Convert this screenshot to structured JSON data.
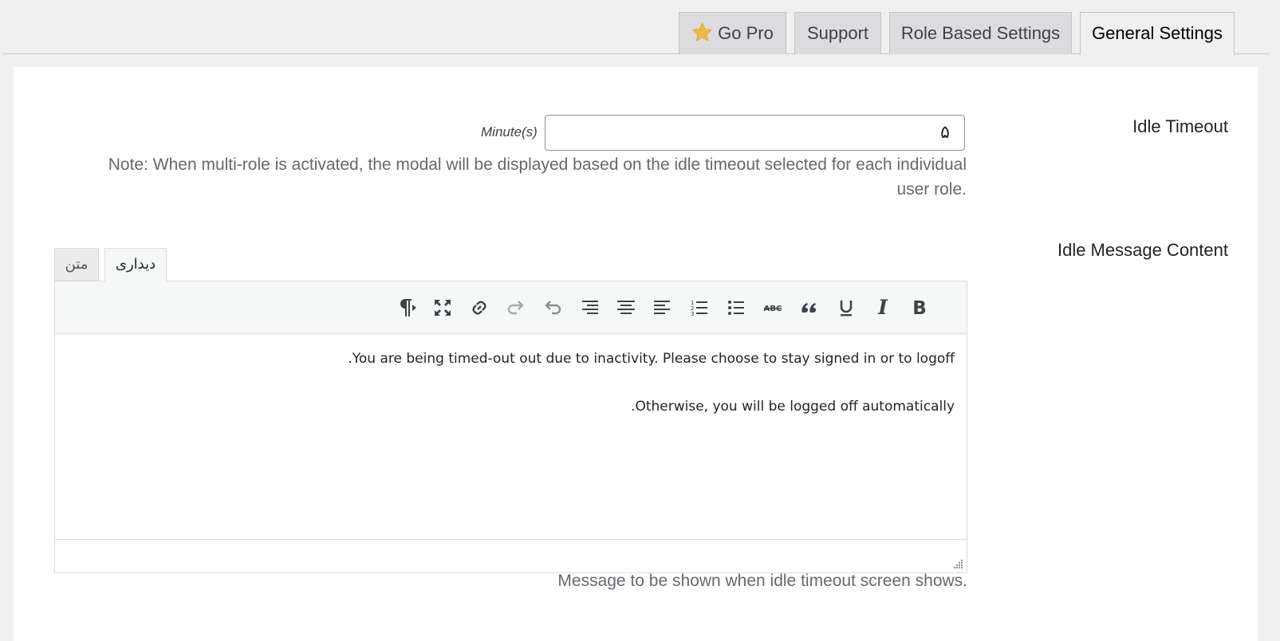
{
  "nav_tabs": [
    {
      "label": "Go Pro",
      "icon": "star-icon",
      "active": false
    },
    {
      "label": "Support",
      "active": false
    },
    {
      "label": "Role Based Settings",
      "active": false
    },
    {
      "label": "General Settings",
      "active": true
    }
  ],
  "idle_timeout": {
    "label": "Idle Timeout",
    "value": "۵",
    "unit": "Minute(s)",
    "note": "Note: When multi-role is activated, the modal will be displayed based on the idle timeout selected for each individual user role."
  },
  "idle_message": {
    "label": "Idle Message Content",
    "mode_tabs": [
      {
        "label": "دیداری",
        "active": true
      },
      {
        "label": "متن",
        "active": false
      }
    ],
    "toolbar_icons": [
      "bold-icon",
      "italic-icon",
      "underline-icon",
      "blockquote-icon",
      "strikethrough-icon",
      "bullet-list-icon",
      "numbered-list-icon",
      "align-left-icon",
      "align-center-icon",
      "align-right-icon",
      "undo-icon",
      "redo-icon",
      "link-icon",
      "fullscreen-icon",
      "text-direction-icon"
    ],
    "paragraphs": [
      "You are being timed-out out due to inactivity. Please choose to stay signed in or to logoff.",
      "Otherwise, you will be logged off automatically."
    ],
    "help": "Message to be shown when idle timeout screen shows."
  },
  "colors": {
    "accent_star": "#f0b849",
    "text_primary": "#1d2327",
    "text_muted": "#646970",
    "border": "#c3c4c7"
  }
}
